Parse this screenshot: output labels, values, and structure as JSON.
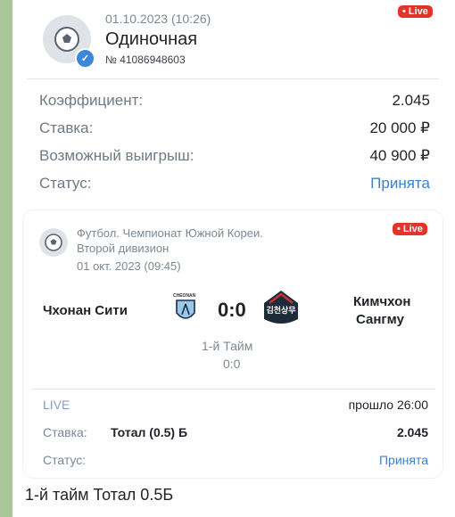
{
  "bet": {
    "datetime": "01.10.2023 (10:26)",
    "live_badge": "• Live",
    "type": "Одиночная",
    "number": "№ 41086948603",
    "rows": [
      {
        "label": "Коэффициент:",
        "value": "2.045"
      },
      {
        "label": "Ставка:",
        "value": "20 000 ₽"
      },
      {
        "label": "Возможный выигрыш:",
        "value": "40 900 ₽"
      },
      {
        "label": "Статус:",
        "value": "Принята"
      }
    ]
  },
  "event": {
    "live_badge": "• Live",
    "league_line1": "Футбол. Чемпионат Южной Кореи.",
    "league_line2": "Второй дивизион",
    "datetime": "01 окт. 2023 (09:45)",
    "home_team": "Чхонан Сити",
    "home_logo_text": "CHEONAN",
    "score": "0:0",
    "away_logo_text": "김천상무",
    "away_team_line1": "Кимчхон",
    "away_team_line2": "Сангму",
    "period": "1-й Тайм",
    "period_score": "0:0",
    "live_label": "LIVE",
    "elapsed": "прошло 26:00",
    "stake_label": "Ставка:",
    "stake_value": "Тотал (0.5) Б",
    "stake_coef": "2.045",
    "status_label": "Статус:",
    "status_value": "Принята"
  },
  "caption": "1-й тайм Тотал 0.5Б",
  "colors": {
    "accent": "#3a82d0",
    "live": "#e5332a",
    "background": "#a9c79a"
  }
}
